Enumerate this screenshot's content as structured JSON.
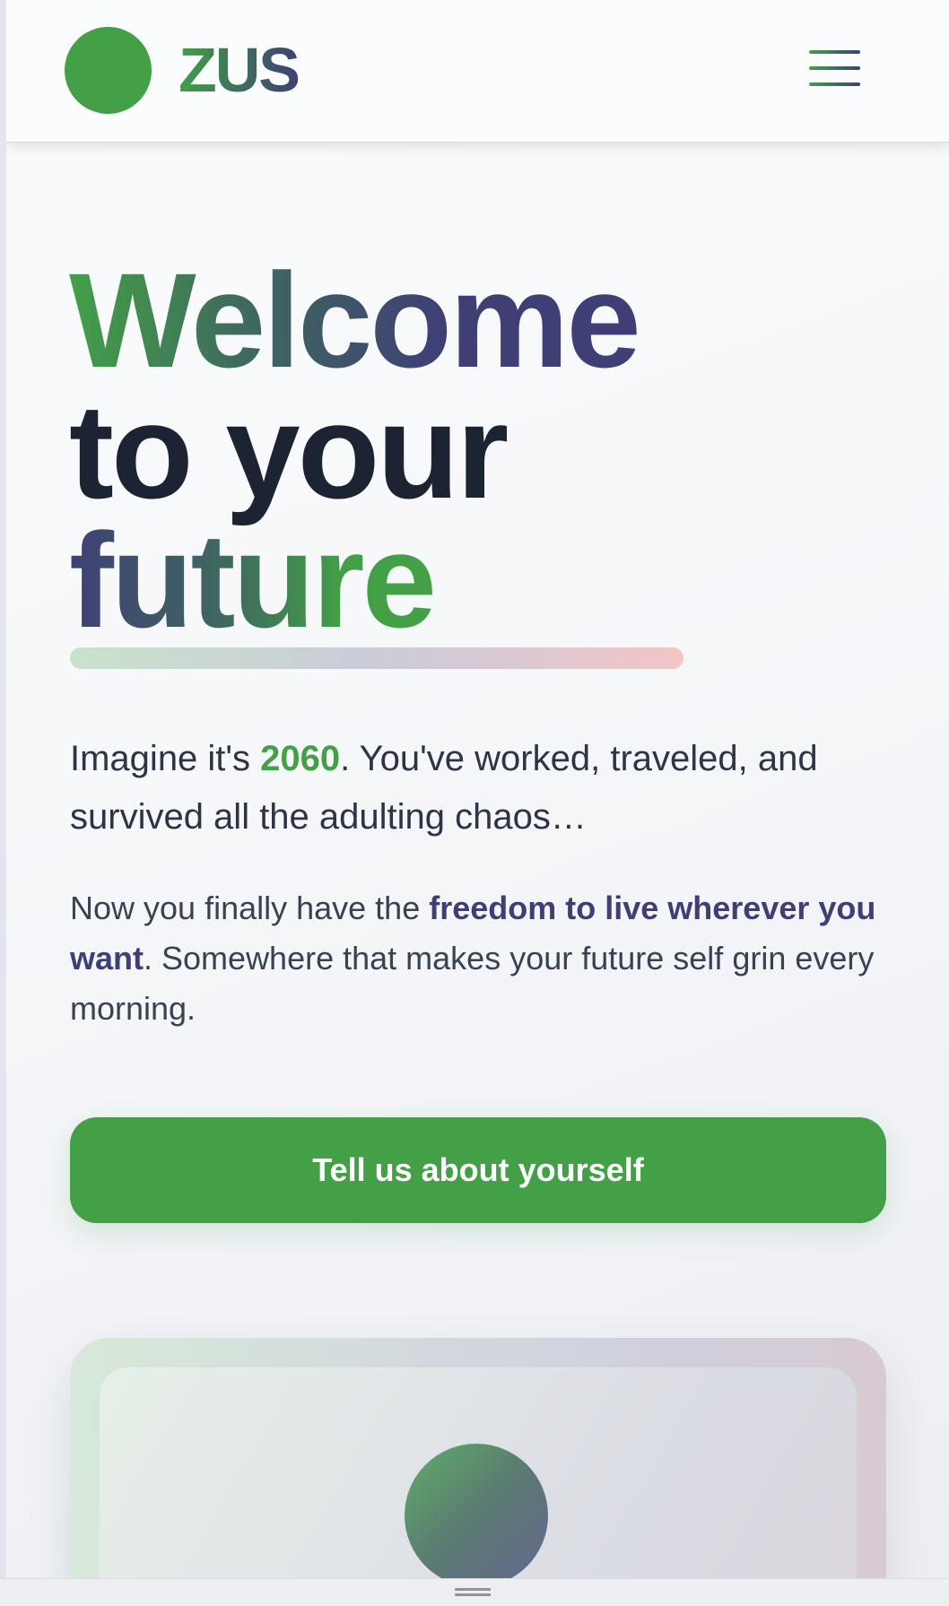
{
  "header": {
    "logo_text": "ZUS",
    "menu_icon": "hamburger-menu-icon"
  },
  "hero": {
    "title_line_1": "Welcome",
    "title_line_2": "to your",
    "title_line_3": "future"
  },
  "intro": {
    "p1_before": "Imagine it's ",
    "p1_highlight": "2060",
    "p1_after": ". You've worked, traveled, and survived all the adulting chaos…",
    "p2_before": "Now you finally have the ",
    "p2_highlight": "freedom to live wherever you want",
    "p2_after": ". Somewhere that makes your future self grin every morning."
  },
  "cta": {
    "label": "Tell us about yourself"
  },
  "colors": {
    "brand_green": "#43a047",
    "brand_purple": "#3f3f75",
    "heading_dark": "#1c2433"
  }
}
